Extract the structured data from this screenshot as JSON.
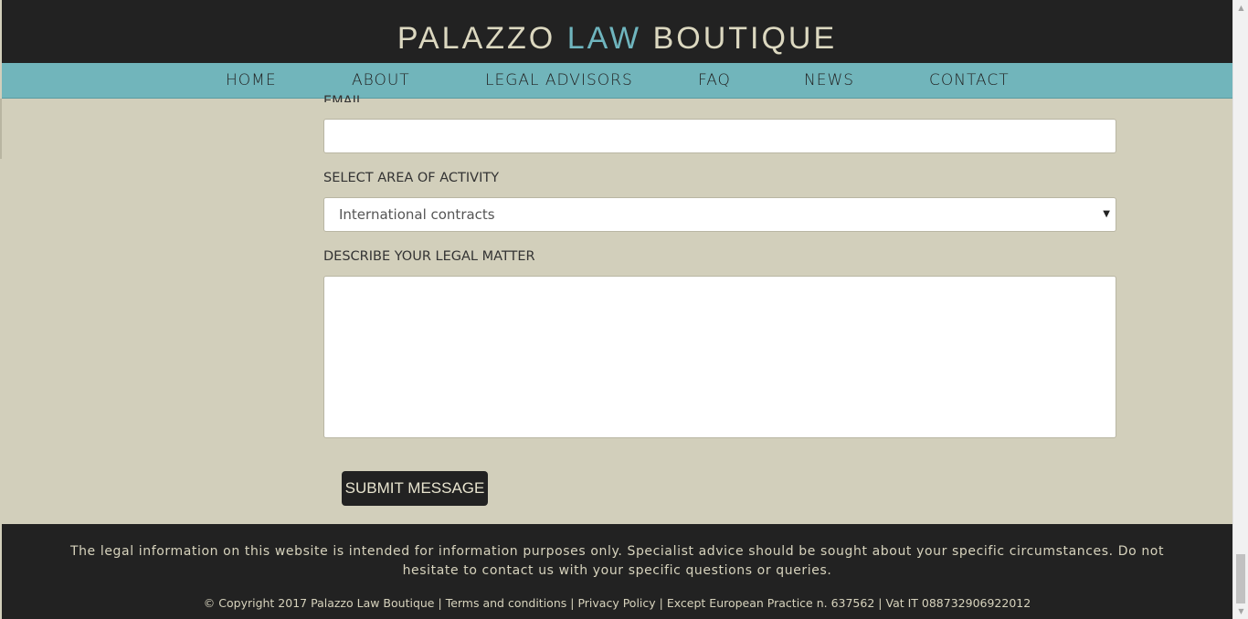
{
  "brand": {
    "part1": "PALAZZO",
    "part2": "LAW",
    "part3": "BOUTIQUE",
    "accent_color": "#6fb5be"
  },
  "nav": {
    "items": [
      {
        "label": "HOME"
      },
      {
        "label": "ABOUT"
      },
      {
        "label": "LEGAL ADVISORS"
      },
      {
        "label": "FAQ"
      },
      {
        "label": "NEWS"
      },
      {
        "label": "CONTACT"
      }
    ],
    "background_color": "#71b5bb"
  },
  "form": {
    "email_label": "EMAIL",
    "email_value": "",
    "area_label": "SELECT AREA OF ACTIVITY",
    "area_selected": "International contracts",
    "matter_label": "DESCRIBE YOUR LEGAL MATTER",
    "matter_value": "",
    "submit_label": "SUBMIT MESSAGE"
  },
  "footer": {
    "disclaimer": "The legal information on this website is intended for information purposes only. Specialist advice should be sought about your specific circumstances. Do not hesitate to contact us with your specific questions or queries.",
    "copyright": "© Copyright 2017 Palazzo Law Boutique",
    "terms": "Terms and conditions",
    "privacy": "Privacy Policy",
    "practice": "Except European Practice n. 637562",
    "vat": "Vat IT 088732906922012",
    "separator": "|"
  },
  "colors": {
    "dark": "#222222",
    "page_bg": "#d2cfbb",
    "nav": "#71b5bb"
  }
}
